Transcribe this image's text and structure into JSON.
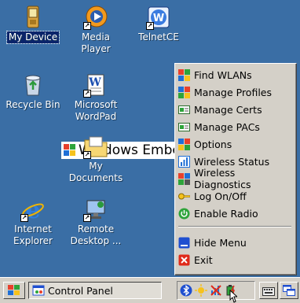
{
  "desktop": {
    "icons": [
      {
        "label": "My Device",
        "icon": "my-device-icon"
      },
      {
        "label": "Media Player",
        "icon": "media-player-icon"
      },
      {
        "label": "TelnetCE",
        "icon": "telnetce-icon"
      },
      {
        "label": "Recycle Bin",
        "icon": "recycle-bin-icon"
      },
      {
        "label": "Microsoft WordPad",
        "icon": "wordpad-icon"
      },
      {
        "label": "My Documents",
        "icon": "my-documents-icon"
      },
      {
        "label": "Internet Explorer",
        "icon": "internet-explorer-icon"
      },
      {
        "label": "Remote Desktop ...",
        "icon": "remote-desktop-icon"
      }
    ],
    "watermark": "Windows Embe"
  },
  "wlan_menu": {
    "items": [
      {
        "label": "Find WLANs",
        "icon": "find-wlans-icon"
      },
      {
        "label": "Manage Profiles",
        "icon": "manage-profiles-icon"
      },
      {
        "label": "Manage Certs",
        "icon": "manage-certs-icon"
      },
      {
        "label": "Manage PACs",
        "icon": "manage-pacs-icon"
      },
      {
        "label": "Options",
        "icon": "options-icon"
      },
      {
        "label": "Wireless Status",
        "icon": "wireless-status-icon"
      },
      {
        "label": "Wireless Diagnostics",
        "icon": "wireless-diagnostics-icon"
      },
      {
        "label": "Log On/Off",
        "icon": "key-icon"
      },
      {
        "label": "Enable Radio",
        "icon": "power-icon"
      },
      {
        "label": "Hide Menu",
        "icon": "hide-menu-icon"
      },
      {
        "label": "Exit",
        "icon": "exit-icon"
      }
    ]
  },
  "taskbar": {
    "task_label": "Control Panel",
    "tray_icons": [
      "bluetooth-icon",
      "sun-icon",
      "wlan-disabled-icon",
      "battery-icon"
    ]
  },
  "colors": {
    "desktop_bg": "#3a6ea5",
    "chrome": "#d4d0c8",
    "selection": "#0a246a"
  }
}
